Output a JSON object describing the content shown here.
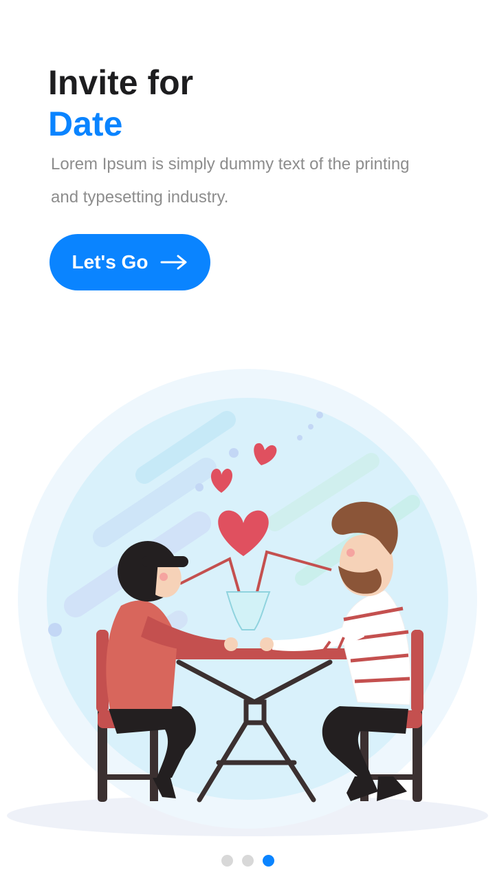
{
  "header": {
    "title_line1": "Invite for",
    "title_line2": "Date"
  },
  "description": "Lorem Ipsum is simply dummy text of the printing and typesetting industry.",
  "cta": {
    "label": "Let's Go",
    "icon": "arrow-right-icon"
  },
  "illustration": {
    "name": "couple-date-illustration"
  },
  "pagination": {
    "total": 3,
    "current": 3
  },
  "colors": {
    "accent": "#0a84ff",
    "title": "#1d1d1f",
    "body_text": "#8d8d8d",
    "dot_inactive": "#d8d8d8"
  }
}
